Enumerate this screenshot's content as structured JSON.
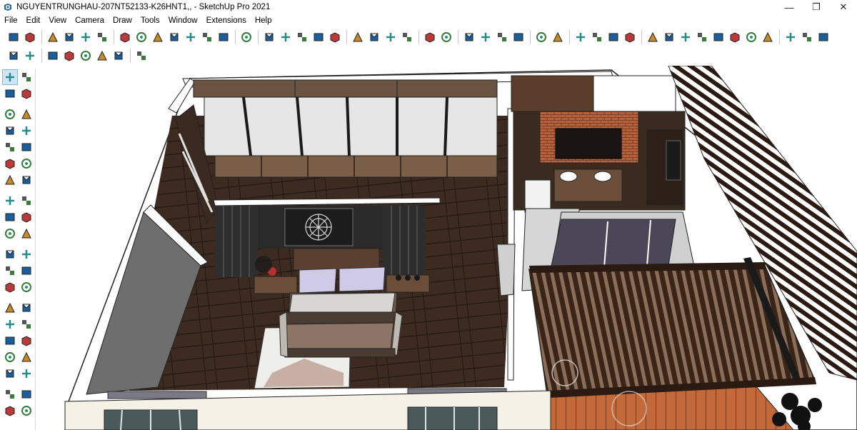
{
  "window": {
    "title": "NGUYENTRUNGHAU-207NT52133-K26HNT1,, - SketchUp Pro 2021",
    "minimize_glyph": "—",
    "maximize_glyph": "❐",
    "close_glyph": "✕"
  },
  "menu": [
    "File",
    "Edit",
    "View",
    "Camera",
    "Draw",
    "Tools",
    "Window",
    "Extensions",
    "Help"
  ],
  "toolbar_row1": [
    "iso-view-icon",
    "top-view-icon",
    "sep",
    "front-view-icon",
    "right-view-icon",
    "back-view-icon",
    "left-view-icon",
    "sep",
    "xray-icon",
    "back-edges-icon",
    "wireframe-icon",
    "hidden-line-icon",
    "shaded-icon",
    "textured-icon",
    "monochrome-icon",
    "sep",
    "components-icon",
    "sep",
    "section-plane-icon",
    "section-cut-icon",
    "section-fill-icon",
    "section-display-icon",
    "section-fill-alt-icon",
    "sep",
    "axes-icon",
    "solid-union-icon",
    "solid-subtract-icon",
    "solid-trim-icon",
    "sep",
    "sandbox-stamp-icon",
    "sandbox-drape-icon",
    "sep",
    "teapot-icon",
    "smooth-icon",
    "spiral-icon",
    "rotate-icon",
    "sep",
    "dimension-icon",
    "text-label-icon",
    "sep",
    "window-frame-icon",
    "panel-icon",
    "copy-icon",
    "lock-icon",
    "sep",
    "gear-icon",
    "lamp-icon",
    "circle-target-icon",
    "triangle-icon",
    "pin-icon",
    "sun-icon",
    "dome-icon",
    "disc-icon",
    "sep",
    "walk-icon",
    "box-icon",
    "cube-icon"
  ],
  "toolbar_row2": [
    "search-icon",
    "component-options-icon",
    "sep",
    "outliner-icon",
    "materials-icon",
    "box-open-icon",
    "box-shell-icon",
    "sphere-icon",
    "sep",
    "extension-manager-icon"
  ],
  "left_tools": [
    [
      "select-arrow-icon",
      "component-icon"
    ],
    [
      "paint-bucket-icon",
      "eraser-icon"
    ],
    [
      "pencil-icon",
      "freehand-icon"
    ],
    [
      "rectangle-icon",
      "rotated-rectangle-icon"
    ],
    [
      "circle-icon",
      "polygon-icon"
    ],
    [
      "arc-icon",
      "two-point-arc-icon"
    ],
    [
      "three-point-arc-icon",
      "pie-icon"
    ],
    [
      "move-icon",
      "push-pull-icon"
    ],
    [
      "rotate-tool-icon",
      "follow-me-icon"
    ],
    [
      "scale-icon",
      "offset-icon"
    ],
    [
      "tape-measure-icon",
      "dimension-tool-icon"
    ],
    [
      "protractor-icon",
      "text-tool-icon"
    ],
    [
      "axes-tool-icon",
      "3d-text-icon"
    ],
    [
      "orbit-icon",
      "pan-icon"
    ],
    [
      "zoom-icon",
      "zoom-window-icon"
    ],
    [
      "zoom-extents-icon",
      "previous-view-icon"
    ],
    [
      "position-camera-icon",
      "look-around-icon"
    ],
    [
      "walk-tool-icon",
      "section-tool-icon"
    ],
    [
      "sandbox-contours-icon",
      "sandbox-scratch-icon"
    ],
    [
      "smoove-icon",
      "stamp-icon"
    ]
  ],
  "colors": {
    "floor_dark": "#3d2b22",
    "floor_plank_line": "#261a14",
    "wall_gray": "#7a7a7a",
    "wall_top": "#ffffff",
    "pergola_brown": "#3a2418",
    "deck_orange": "#c46a3a",
    "wardrobe_panel": "#e8e8e8",
    "wardrobe_wood": "#7a5e48",
    "brick": "#b8623c",
    "bed_sheet": "#c9c3bd",
    "pillow": "#cfcbe6",
    "rug_white": "#eeeeea",
    "blind_purple": "#4b4758",
    "accent_blue": "#7eb4ea"
  }
}
